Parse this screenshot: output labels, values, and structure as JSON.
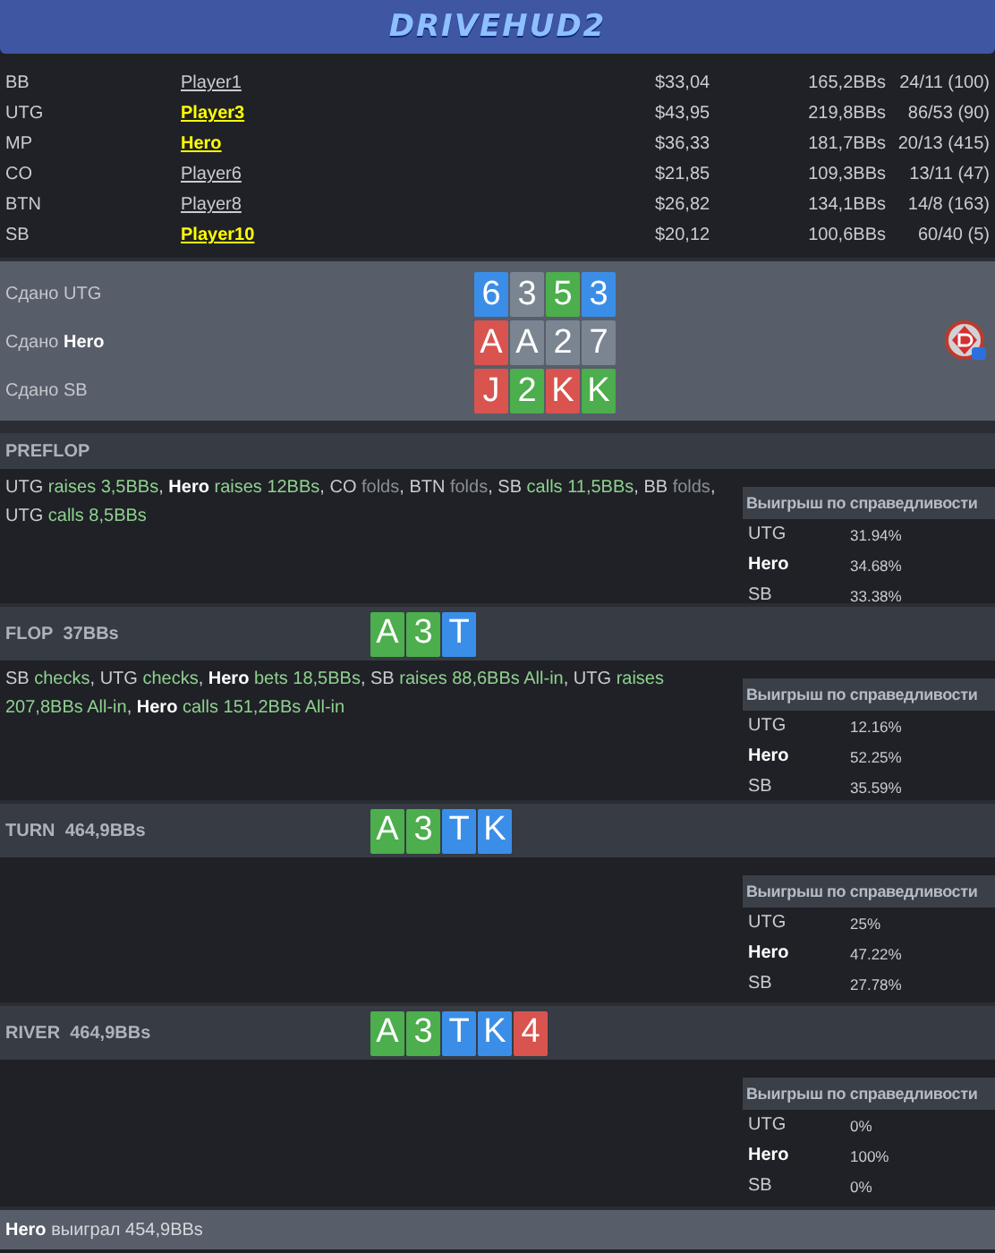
{
  "header": {
    "logo": "DRIVEHUD2"
  },
  "players": [
    {
      "position": "BB",
      "name": "Player1",
      "highlighted": false,
      "stack": "$33,04",
      "bbs": "165,2BBs",
      "stats": "24/11 (100)"
    },
    {
      "position": "UTG",
      "name": "Player3",
      "highlighted": true,
      "stack": "$43,95",
      "bbs": "219,8BBs",
      "stats": "86/53 (90)"
    },
    {
      "position": "MP",
      "name": "Hero",
      "highlighted": true,
      "stack": "$36,33",
      "bbs": "181,7BBs",
      "stats": "20/13 (415)"
    },
    {
      "position": "CO",
      "name": "Player6",
      "highlighted": false,
      "stack": "$21,85",
      "bbs": "109,3BBs",
      "stats": "13/11 (47)"
    },
    {
      "position": "BTN",
      "name": "Player8",
      "highlighted": false,
      "stack": "$26,82",
      "bbs": "134,1BBs",
      "stats": "14/8 (163)"
    },
    {
      "position": "SB",
      "name": "Player10",
      "highlighted": true,
      "stack": "$20,12",
      "bbs": "100,6BBs",
      "stats": "60/40 (5)"
    }
  ],
  "dealt": [
    {
      "label": "Сдано",
      "player": "UTG",
      "hero": false,
      "cards": [
        {
          "rank": "6",
          "color": "#3b8ee8"
        },
        {
          "rank": "3",
          "color": "#7b8591"
        },
        {
          "rank": "5",
          "color": "#4cae4c"
        },
        {
          "rank": "3",
          "color": "#3b8ee8"
        }
      ]
    },
    {
      "label": "Сдано",
      "player": "Hero",
      "hero": true,
      "cards": [
        {
          "rank": "A",
          "color": "#d9534f"
        },
        {
          "rank": "A",
          "color": "#7b8591"
        },
        {
          "rank": "2",
          "color": "#7b8591"
        },
        {
          "rank": "7",
          "color": "#7b8591"
        }
      ]
    },
    {
      "label": "Сдано",
      "player": "SB",
      "hero": false,
      "cards": [
        {
          "rank": "J",
          "color": "#d9534f"
        },
        {
          "rank": "2",
          "color": "#4cae4c"
        },
        {
          "rank": "K",
          "color": "#d9534f"
        },
        {
          "rank": "K",
          "color": "#4cae4c"
        }
      ]
    }
  ],
  "streets": [
    {
      "name": "PREFLOP",
      "actions": [
        {
          "player": "UTG",
          "hero": false,
          "verb": "raises 3,5BBs",
          "kind": "active",
          "sep": ","
        },
        {
          "player": "Hero",
          "hero": true,
          "verb": "raises 12BBs",
          "kind": "active",
          "sep": ","
        },
        {
          "player": "CO",
          "hero": false,
          "verb": "folds",
          "kind": "fold",
          "sep": ","
        },
        {
          "player": "BTN",
          "hero": false,
          "verb": "folds",
          "kind": "fold",
          "sep": ","
        },
        {
          "player": "SB",
          "hero": false,
          "verb": "calls 11,5BBs",
          "kind": "active",
          "sep": ","
        },
        {
          "player": "BB",
          "hero": false,
          "verb": "folds",
          "kind": "fold",
          "sep": ","
        },
        {
          "player": "UTG",
          "hero": false,
          "verb": "calls 8,5BBs",
          "kind": "active"
        }
      ],
      "equity": {
        "title": "Выигрыш по справедливости",
        "rows": [
          {
            "player": "UTG",
            "hero": false,
            "value": "31.94%"
          },
          {
            "player": "Hero",
            "hero": true,
            "value": "34.68%"
          },
          {
            "player": "SB",
            "hero": false,
            "value": "33.38%"
          }
        ]
      }
    },
    {
      "name": "FLOP",
      "pot": "37BBs",
      "board": [
        {
          "rank": "A",
          "color": "#4cae4c"
        },
        {
          "rank": "3",
          "color": "#4cae4c"
        },
        {
          "rank": "T",
          "color": "#3b8ee8"
        }
      ],
      "actions": [
        {
          "player": "SB",
          "hero": false,
          "verb": "checks",
          "kind": "active",
          "sep": ","
        },
        {
          "player": "UTG",
          "hero": false,
          "verb": "checks",
          "kind": "active",
          "sep": ","
        },
        {
          "player": "Hero",
          "hero": true,
          "verb": "bets 18,5BBs",
          "kind": "active",
          "sep": ","
        },
        {
          "player": "SB",
          "hero": false,
          "verb": "raises 88,6BBs All-in",
          "kind": "active",
          "sep": ","
        },
        {
          "player": "UTG",
          "hero": false,
          "verb": "raises 207,8BBs All-in",
          "kind": "active",
          "sep": ","
        },
        {
          "player": "Hero",
          "hero": true,
          "verb": "calls 151,2BBs All-in",
          "kind": "active"
        }
      ],
      "equity": {
        "title": "Выигрыш по справедливости",
        "rows": [
          {
            "player": "UTG",
            "hero": false,
            "value": "12.16%"
          },
          {
            "player": "Hero",
            "hero": true,
            "value": "52.25%"
          },
          {
            "player": "SB",
            "hero": false,
            "value": "35.59%"
          }
        ]
      }
    },
    {
      "name": "TURN",
      "pot": "464,9BBs",
      "board": [
        {
          "rank": "A",
          "color": "#4cae4c"
        },
        {
          "rank": "3",
          "color": "#4cae4c"
        },
        {
          "rank": "T",
          "color": "#3b8ee8"
        },
        {
          "rank": "K",
          "color": "#3b8ee8"
        }
      ],
      "equity": {
        "title": "Выигрыш по справедливости",
        "rows": [
          {
            "player": "UTG",
            "hero": false,
            "value": "25%"
          },
          {
            "player": "Hero",
            "hero": true,
            "value": "47.22%"
          },
          {
            "player": "SB",
            "hero": false,
            "value": "27.78%"
          }
        ]
      }
    },
    {
      "name": "RIVER",
      "pot": "464,9BBs",
      "board": [
        {
          "rank": "A",
          "color": "#4cae4c"
        },
        {
          "rank": "3",
          "color": "#4cae4c"
        },
        {
          "rank": "T",
          "color": "#3b8ee8"
        },
        {
          "rank": "K",
          "color": "#3b8ee8"
        },
        {
          "rank": "4",
          "color": "#d9534f"
        }
      ],
      "equity": {
        "title": "Выигрыш по справедливости",
        "rows": [
          {
            "player": "UTG",
            "hero": false,
            "value": "0%"
          },
          {
            "player": "Hero",
            "hero": true,
            "value": "100%"
          },
          {
            "player": "SB",
            "hero": false,
            "value": "0%"
          }
        ]
      }
    }
  ],
  "result": {
    "player": "Hero",
    "text": "выиграл 454,9BBs"
  }
}
